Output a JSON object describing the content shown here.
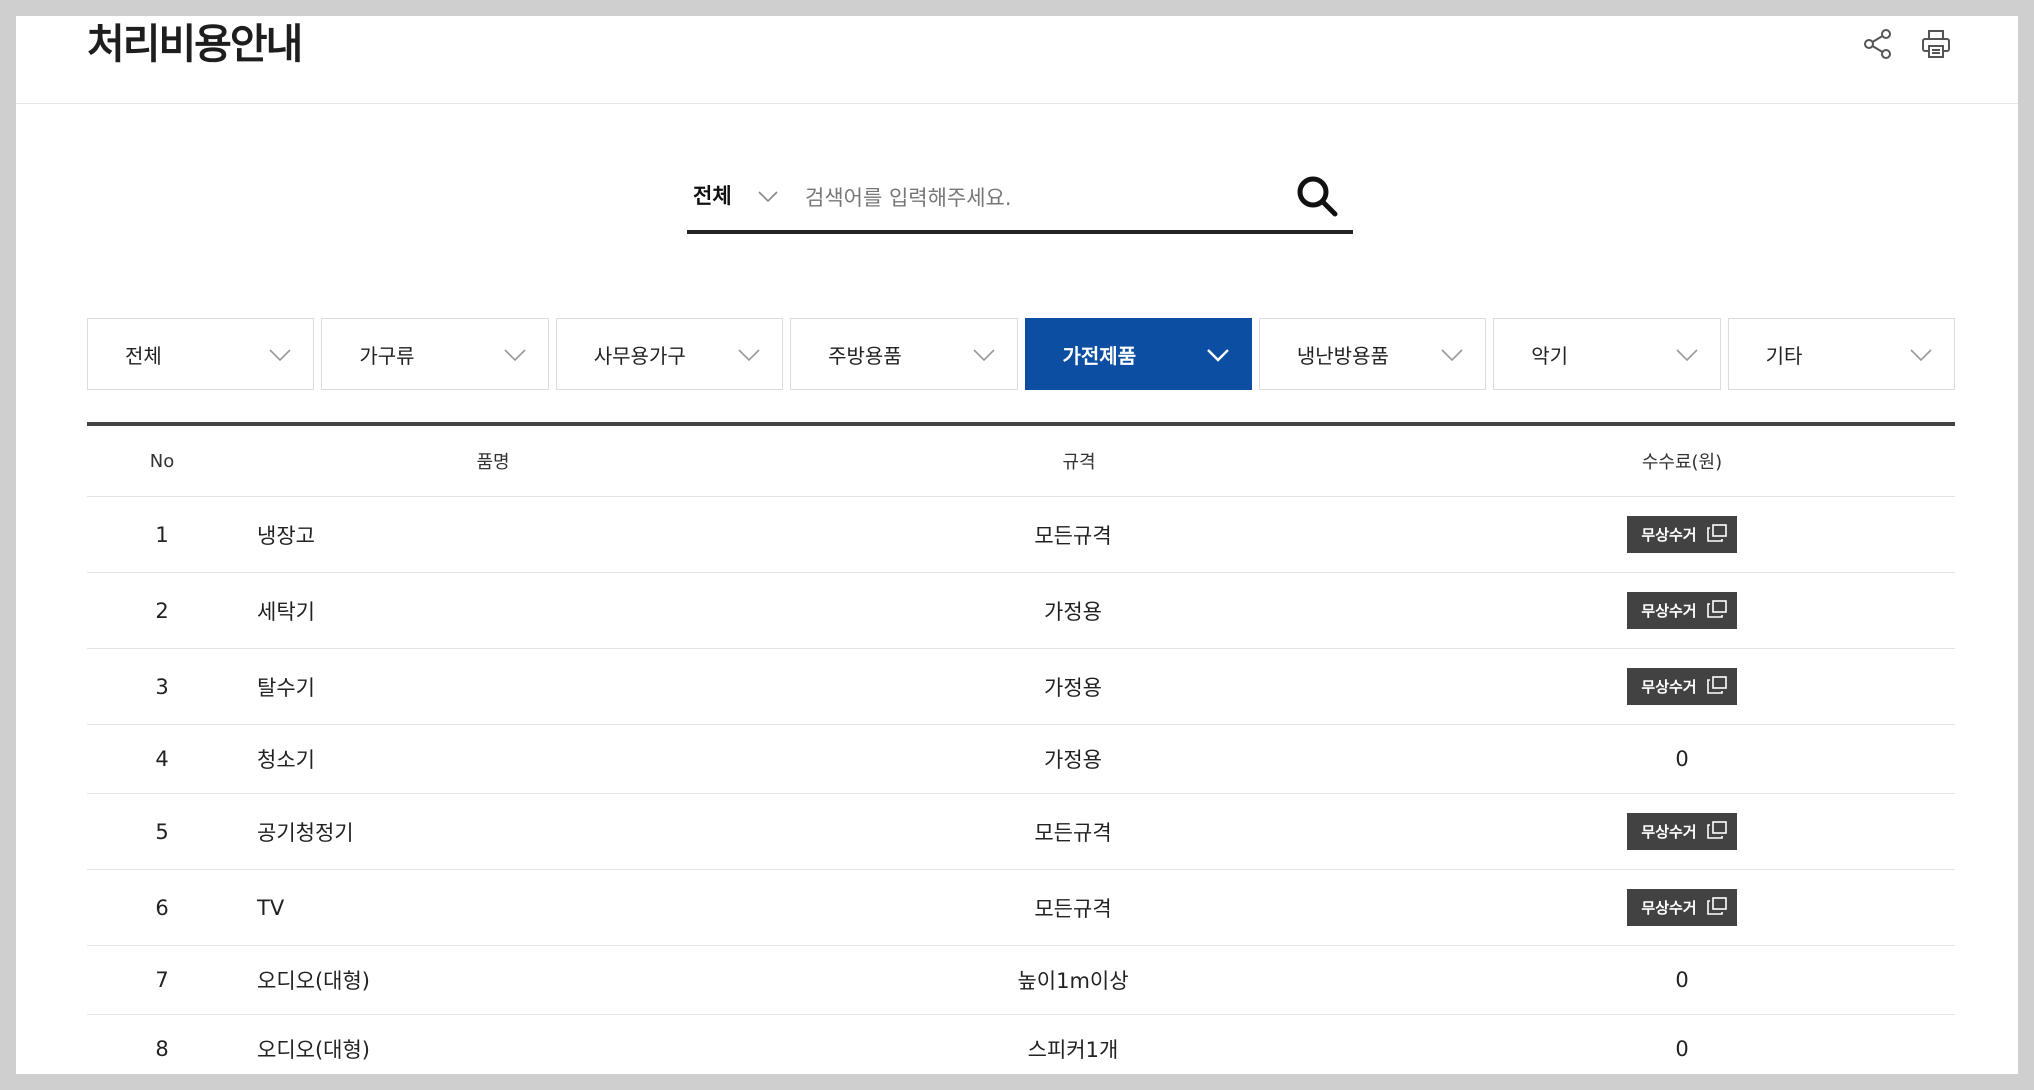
{
  "header": {
    "title": "처리비용안내"
  },
  "search": {
    "select_label": "전체",
    "placeholder": "검색어를 입력해주세요."
  },
  "categories": [
    {
      "label": "전체",
      "active": false
    },
    {
      "label": "가구류",
      "active": false
    },
    {
      "label": "사무용가구",
      "active": false
    },
    {
      "label": "주방용품",
      "active": false
    },
    {
      "label": "가전제품",
      "active": true
    },
    {
      "label": "냉난방용품",
      "active": false
    },
    {
      "label": "악기",
      "active": false
    },
    {
      "label": "기타",
      "active": false
    }
  ],
  "table": {
    "headers": {
      "no": "No",
      "name": "품명",
      "spec": "규격",
      "fee": "수수료(원)"
    },
    "rows": [
      {
        "no": "1",
        "name": "냉장고",
        "spec": "모든규격",
        "fee": "무상수거",
        "fee_is_button": true
      },
      {
        "no": "2",
        "name": "세탁기",
        "spec": "가정용",
        "fee": "무상수거",
        "fee_is_button": true
      },
      {
        "no": "3",
        "name": "탈수기",
        "spec": "가정용",
        "fee": "무상수거",
        "fee_is_button": true
      },
      {
        "no": "4",
        "name": "청소기",
        "spec": "가정용",
        "fee": "0",
        "fee_is_button": false
      },
      {
        "no": "5",
        "name": "공기청정기",
        "spec": "모든규격",
        "fee": "무상수거",
        "fee_is_button": true
      },
      {
        "no": "6",
        "name": "TV",
        "spec": "모든규격",
        "fee": "무상수거",
        "fee_is_button": true
      },
      {
        "no": "7",
        "name": "오디오(대형)",
        "spec": "높이1m이상",
        "fee": "0",
        "fee_is_button": false
      },
      {
        "no": "8",
        "name": "오디오(대형)",
        "spec": "스피커1개",
        "fee": "0",
        "fee_is_button": false
      }
    ]
  },
  "icons": {
    "share": "share-icon",
    "print": "print-icon",
    "search": "search-icon",
    "chevron": "chevron-down-icon",
    "popup": "new-window-icon"
  },
  "colors": {
    "active_tab": "#0b4ea2",
    "free_button": "#424242"
  }
}
